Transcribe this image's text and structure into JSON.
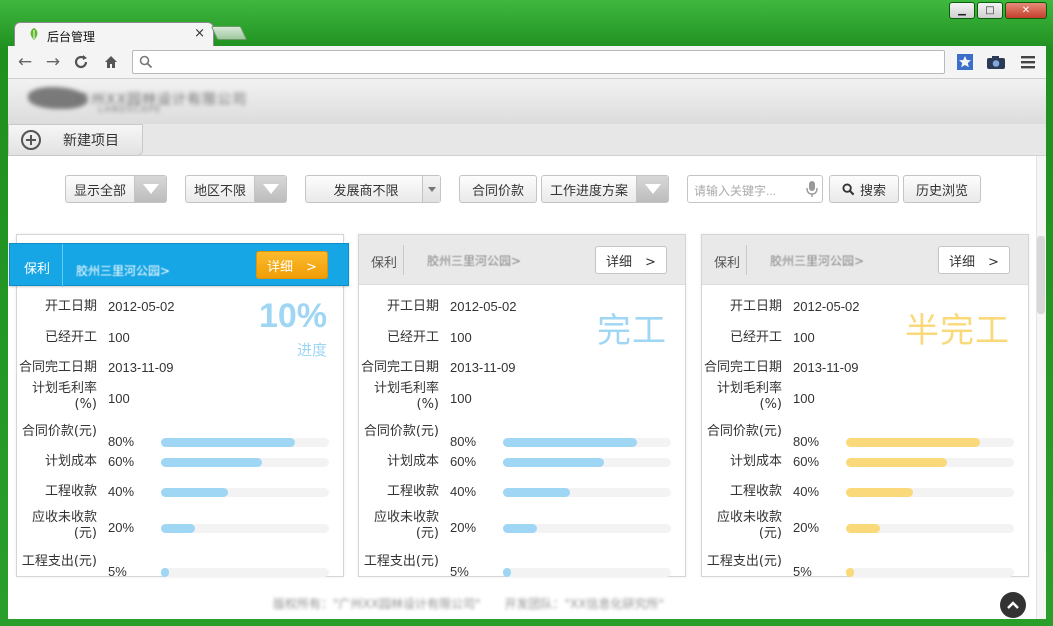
{
  "browser": {
    "tab_title": "后台管理",
    "tab_close": "×"
  },
  "header": {
    "company_name": "广州XX园林设计有限公司",
    "company_sub": "LANDSCAPE"
  },
  "subbar": {
    "new_project_label": "新建项目"
  },
  "filters": {
    "show_all": "显示全部",
    "region": "地区不限",
    "developer": "发展商不限",
    "contract_price": "合同价款",
    "progress_plan": "工作进度方案",
    "search_placeholder": "请输入关键字...",
    "search_label": "搜索",
    "history_label": "历史浏览"
  },
  "cards": [
    {
      "developer": "保利",
      "project": "胶州三里河公园>",
      "detail_label": "详细　>",
      "status_big": "10%",
      "status_sub": "进度",
      "rows": [
        {
          "k": "开工日期",
          "v": "2012-05-02"
        },
        {
          "k": "已经开工",
          "v": "100"
        },
        {
          "k": "合同完工日期",
          "v": "2013-11-09"
        },
        {
          "k": "计划毛利率(%)",
          "v": "100"
        }
      ],
      "bars": [
        {
          "k": "合同价款(元)",
          "v": "80%",
          "pct": 80
        },
        {
          "k": "计划成本",
          "v": "60%",
          "pct": 60
        },
        {
          "k": "工程收款",
          "v": "40%",
          "pct": 40
        },
        {
          "k": "应收未收款(元)",
          "v": "20%",
          "pct": 20
        },
        {
          "k": "工程支出(元)",
          "v": "5%",
          "pct": 5
        }
      ],
      "color": "#9ed6f4"
    },
    {
      "developer": "保利",
      "project": "胶州三里河公园>",
      "detail_label": "详细　>",
      "status_big": "完工",
      "rows": [
        {
          "k": "开工日期",
          "v": "2012-05-02"
        },
        {
          "k": "已经开工",
          "v": "100"
        },
        {
          "k": "合同完工日期",
          "v": "2013-11-09"
        },
        {
          "k": "计划毛利率(%)",
          "v": "100"
        }
      ],
      "bars": [
        {
          "k": "合同价款(元)",
          "v": "80%",
          "pct": 80
        },
        {
          "k": "计划成本",
          "v": "60%",
          "pct": 60
        },
        {
          "k": "工程收款",
          "v": "40%",
          "pct": 40
        },
        {
          "k": "应收未收款(元)",
          "v": "20%",
          "pct": 20
        },
        {
          "k": "工程支出(元)",
          "v": "5%",
          "pct": 5
        }
      ],
      "color": "#9ed6f4"
    },
    {
      "developer": "保利",
      "project": "胶州三里河公园>",
      "detail_label": "详细　>",
      "status_big": "半完工",
      "rows": [
        {
          "k": "开工日期",
          "v": "2012-05-02"
        },
        {
          "k": "已经开工",
          "v": "100"
        },
        {
          "k": "合同完工日期",
          "v": "2013-11-09"
        },
        {
          "k": "计划毛利率(%)",
          "v": "100"
        }
      ],
      "bars": [
        {
          "k": "合同价款(元)",
          "v": "80%",
          "pct": 80
        },
        {
          "k": "计划成本",
          "v": "60%",
          "pct": 60
        },
        {
          "k": "工程收款",
          "v": "40%",
          "pct": 40
        },
        {
          "k": "应收未收款(元)",
          "v": "20%",
          "pct": 20
        },
        {
          "k": "工程支出(元)",
          "v": "5%",
          "pct": 5
        }
      ],
      "color": "#f9d97a"
    }
  ],
  "footer": {
    "text": "版权所有：\"广州XX园林设计有限公司\"　　开发团队：\"XX信息化研究所\""
  },
  "colors": {
    "accent": "#16a6e6",
    "active_detail": "#f5a800",
    "bar_blue": "#9ed6f4",
    "bar_yellow": "#f9d97a"
  }
}
